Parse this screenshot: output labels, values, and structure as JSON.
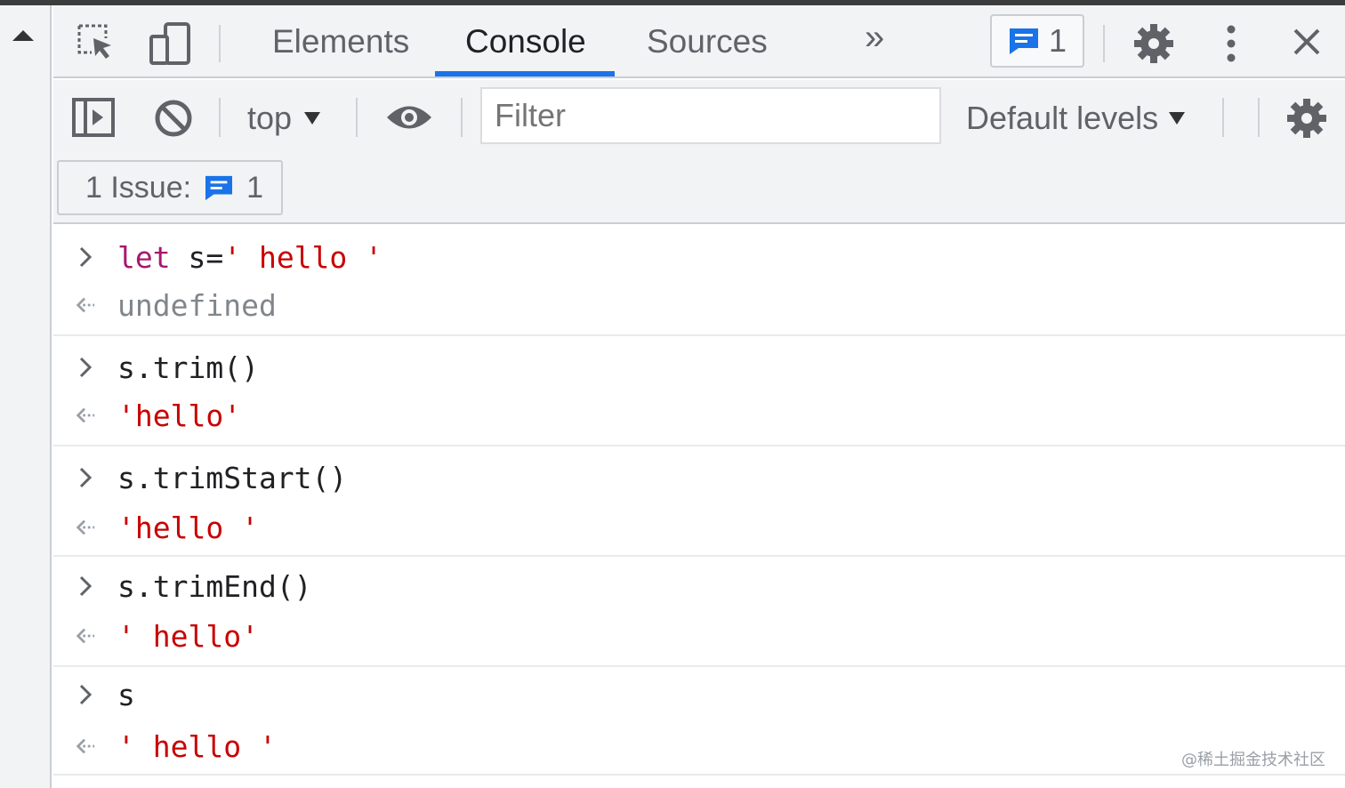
{
  "tabs": {
    "elements": "Elements",
    "console": "Console",
    "sources": "Sources",
    "more": "»",
    "issues_badge_count": "1"
  },
  "toolbar": {
    "context": "top",
    "filter_placeholder": "Filter",
    "levels": "Default levels"
  },
  "issues_bar": {
    "label": "1 Issue:",
    "count": "1"
  },
  "console": {
    "entries": [
      {
        "input_kw": "let",
        "input_rest": " s=",
        "input_str": "' hello '",
        "output": "undefined"
      },
      {
        "input": "s.trim()",
        "output": "'hello'"
      },
      {
        "input": "s.trimStart()",
        "output": "'hello '"
      },
      {
        "input": "s.trimEnd()",
        "output": "' hello'"
      },
      {
        "input": "s",
        "output": "' hello '"
      }
    ]
  },
  "watermark": "@稀土掘金技术社区",
  "colors": {
    "accent": "#1a73e8",
    "keyword": "#a8176f",
    "string": "#c80000",
    "undefined": "#80868b"
  }
}
